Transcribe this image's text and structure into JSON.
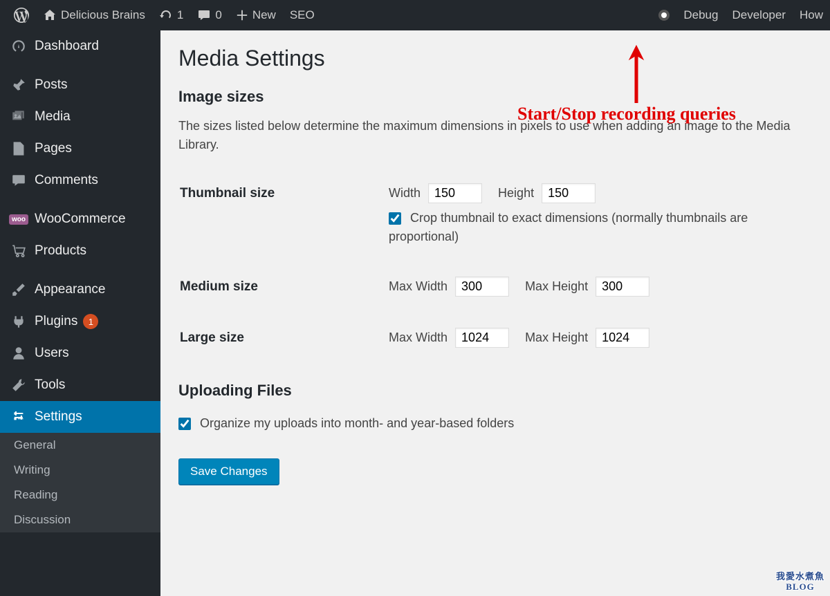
{
  "adminbar": {
    "site_name": "Delicious Brains",
    "update_count": "1",
    "comment_count": "0",
    "new_label": "New",
    "seo_label": "SEO",
    "debug_label": "Debug",
    "developer_label": "Developer",
    "how_label": "How"
  },
  "sidebar": {
    "dashboard": "Dashboard",
    "posts": "Posts",
    "media": "Media",
    "pages": "Pages",
    "comments": "Comments",
    "woocommerce": "WooCommerce",
    "products": "Products",
    "appearance": "Appearance",
    "plugins": "Plugins",
    "plugins_badge": "1",
    "users": "Users",
    "tools": "Tools",
    "settings": "Settings",
    "submenu": {
      "general": "General",
      "writing": "Writing",
      "reading": "Reading",
      "discussion": "Discussion"
    },
    "woo_tag": "woo"
  },
  "page": {
    "title": "Media Settings",
    "image_sizes_heading": "Image sizes",
    "image_sizes_desc": "The sizes listed below determine the maximum dimensions in pixels to use when adding an image to the Media Library.",
    "thumbnail_label": "Thumbnail size",
    "width_label": "Width",
    "height_label": "Height",
    "thumb_width": "150",
    "thumb_height": "150",
    "crop_label": "Crop thumbnail to exact dimensions (normally thumbnails are proportional)",
    "medium_label": "Medium size",
    "max_width_label": "Max Width",
    "max_height_label": "Max Height",
    "medium_width": "300",
    "medium_height": "300",
    "large_label": "Large size",
    "large_width": "1024",
    "large_height": "1024",
    "uploading_heading": "Uploading Files",
    "organize_label": "Organize my uploads into month- and year-based folders",
    "save_button": "Save Changes"
  },
  "annotation": {
    "text": "Start/Stop recording queries"
  },
  "watermark": {
    "line2": "BLOG"
  }
}
